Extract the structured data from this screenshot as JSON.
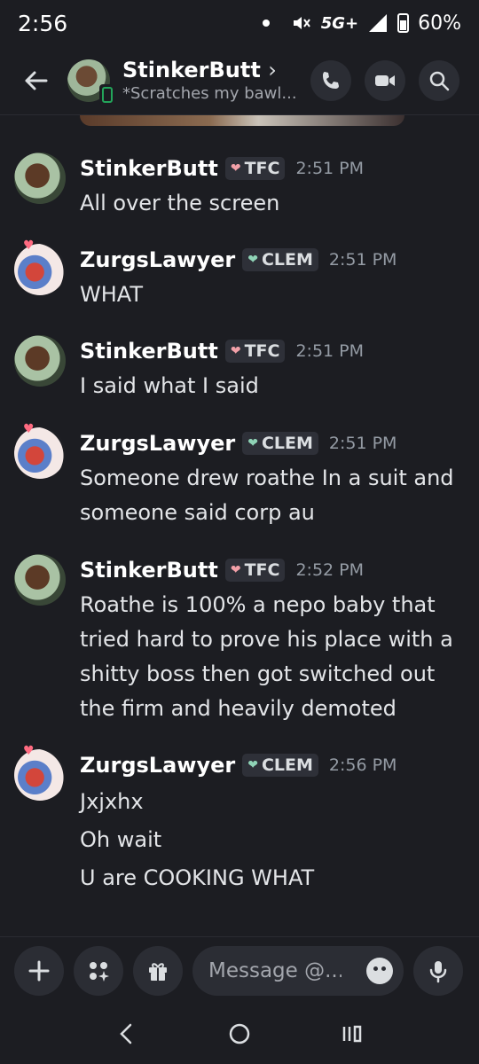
{
  "status_bar": {
    "time": "2:56",
    "network": "5G+",
    "battery": "60%"
  },
  "header": {
    "name": "StinkerButt",
    "chevron": "›",
    "status": "*Scratches my bawl..."
  },
  "messages": [
    {
      "user": "StinkerButt",
      "tag": "TFC",
      "tag_heart_color": "#f2a0a8",
      "time": "2:51 PM",
      "avatar": "stinker",
      "lines": [
        "All over the screen"
      ]
    },
    {
      "user": "ZurgsLawyer",
      "tag": "CLEM",
      "tag_heart_color": "#8fd3b6",
      "time": "2:51 PM",
      "avatar": "zurg",
      "lines": [
        "WHAT"
      ]
    },
    {
      "user": "StinkerButt",
      "tag": "TFC",
      "tag_heart_color": "#f2a0a8",
      "time": "2:51 PM",
      "avatar": "stinker",
      "lines": [
        "I said what I said"
      ]
    },
    {
      "user": "ZurgsLawyer",
      "tag": "CLEM",
      "tag_heart_color": "#8fd3b6",
      "time": "2:51 PM",
      "avatar": "zurg",
      "lines": [
        "Someone drew roathe In a suit and",
        "someone said corp au"
      ]
    },
    {
      "user": "StinkerButt",
      "tag": "TFC",
      "tag_heart_color": "#f2a0a8",
      "time": "2:52 PM",
      "avatar": "stinker",
      "lines": [
        "Roathe is 100% a nepo baby that",
        "tried hard to prove his place with a",
        "shitty boss then got switched out",
        "the firm and heavily demoted"
      ]
    },
    {
      "user": "ZurgsLawyer",
      "tag": "CLEM",
      "tag_heart_color": "#8fd3b6",
      "time": "2:56 PM",
      "avatar": "zurg",
      "lines": [
        "Jxjxhx"
      ]
    },
    {
      "user": "",
      "tag": "",
      "time": "",
      "avatar": "",
      "lines": [
        "Oh wait"
      ]
    },
    {
      "user": "",
      "tag": "",
      "time": "",
      "avatar": "",
      "lines": [
        "U are COOKING WHAT"
      ]
    }
  ],
  "composer": {
    "placeholder": "Message @..."
  },
  "icons": [
    "back-arrow-icon",
    "phone-call-icon",
    "video-call-icon",
    "search-icon",
    "plus-icon",
    "apps-icon",
    "gift-icon",
    "emoji-icon",
    "microphone-icon",
    "nav-back-icon",
    "nav-home-icon",
    "nav-recents-icon"
  ],
  "colors": {
    "background": "#1c1d22",
    "button": "#2b2d34",
    "online": "#23a55a"
  }
}
